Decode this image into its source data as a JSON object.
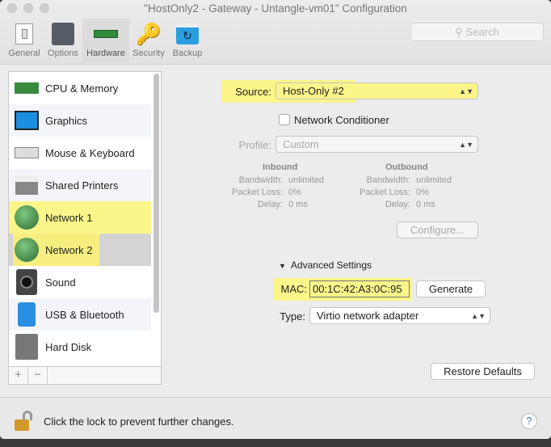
{
  "window": {
    "title": "\"HostOnly2 - Gateway - Untangle-vm01\" Configuration"
  },
  "toolbar": {
    "items": [
      {
        "label": "General",
        "icon": "switch-icon"
      },
      {
        "label": "Options",
        "icon": "sliders-icon"
      },
      {
        "label": "Hardware",
        "icon": "ram-icon"
      },
      {
        "label": "Security",
        "icon": "key-icon"
      },
      {
        "label": "Backup",
        "icon": "backup-icon"
      }
    ],
    "selected": "Hardware",
    "search_placeholder": "Search"
  },
  "sidebar": {
    "items": [
      {
        "label": "CPU & Memory"
      },
      {
        "label": "Graphics"
      },
      {
        "label": "Mouse & Keyboard"
      },
      {
        "label": "Shared Printers"
      },
      {
        "label": "Network 1"
      },
      {
        "label": "Network 2"
      },
      {
        "label": "Sound"
      },
      {
        "label": "USB & Bluetooth"
      },
      {
        "label": "Hard Disk"
      }
    ],
    "selected": "Network 2",
    "add": "+",
    "remove": "−"
  },
  "network": {
    "source_label": "Source:",
    "source_value": "Host-Only #2",
    "conditioner_label": "Network Conditioner",
    "conditioner_checked": false,
    "profile_label": "Profile:",
    "profile_value": "Custom",
    "inbound": {
      "title": "Inbound",
      "bandwidth_label": "Bandwidth:",
      "bandwidth": "unlimited",
      "loss_label": "Packet Loss:",
      "loss": "0%",
      "delay_label": "Delay:",
      "delay": "0 ms"
    },
    "outbound": {
      "title": "Outbound",
      "bandwidth_label": "Bandwidth:",
      "bandwidth": "unlimited",
      "loss_label": "Packet Loss:",
      "loss": "0%",
      "delay_label": "Delay:",
      "delay": "0 ms"
    },
    "configure": "Configure...",
    "advanced": "Advanced Settings",
    "mac_label": "MAC:",
    "mac_value": "00:1C:42:A3:0C:95",
    "generate": "Generate",
    "type_label": "Type:",
    "type_value": "Virtio network adapter",
    "restore": "Restore Defaults"
  },
  "footer": {
    "lock_text": "Click the lock to prevent further changes.",
    "help": "?"
  },
  "colors": {
    "highlight": "#fbf58a",
    "selected_row": "#d4d4d4"
  }
}
